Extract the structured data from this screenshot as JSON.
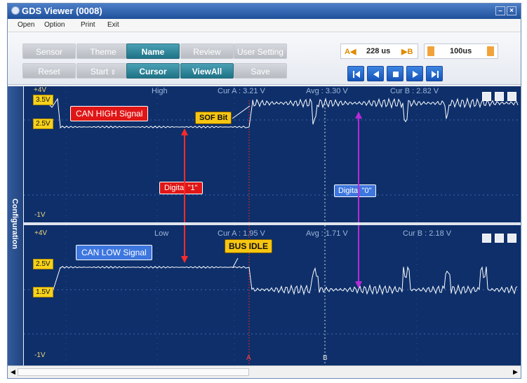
{
  "window": {
    "title": "GDS Viewer (0008)"
  },
  "menu": [
    "Open",
    "Option",
    "Print",
    "Exit"
  ],
  "toolbar": {
    "row1": [
      "Sensor",
      "Theme",
      "Name",
      "Review",
      "User Setting"
    ],
    "row2": [
      "Reset",
      "Start",
      "Cursor",
      "ViewAll",
      "Save"
    ],
    "active": [
      "Name",
      "Cursor",
      "ViewAll"
    ],
    "cursor_a_label": "A◀",
    "cursor_value": "228 us",
    "cursor_b_label": "▶B",
    "time_per_div": "100us"
  },
  "side": {
    "label": "Configuration"
  },
  "panels": {
    "high": {
      "title": "High",
      "cur_a": "Cur A : 3.21 V",
      "avg": "Avg : 3.30 V",
      "cur_b": "Cur B : 2.82 V",
      "top_label": "+4V",
      "bottom_label": "-1V",
      "level_hi": "3.5V",
      "level_lo": "2.5V"
    },
    "low": {
      "title": "Low",
      "cur_a": "Cur A : 1.95 V",
      "avg": "Avg : 1.71 V",
      "cur_b": "Cur B : 2.18 V",
      "top_label": "+4V",
      "bottom_label": "-1V",
      "level_hi": "2.5V",
      "level_lo": "1.5V"
    }
  },
  "annotations": {
    "can_high": "CAN HIGH Signal",
    "can_low": "CAN LOW Signal",
    "sof": "SOF Bit",
    "bus_idle": "BUS IDLE",
    "digital_1": "Digital \"1\"",
    "digital_0": "Digital \"0\"",
    "cursor_a_marker": "A",
    "cursor_b_marker": "B"
  },
  "colors": {
    "panel_bg": "#0e2f6a",
    "trace": "#ffffff",
    "cursor_a": "#e02a2a",
    "cursor_b": "#d8d8d8",
    "digital_0_arrow": "#b82ad6",
    "digital_1_arrow": "#ff2a2a"
  }
}
